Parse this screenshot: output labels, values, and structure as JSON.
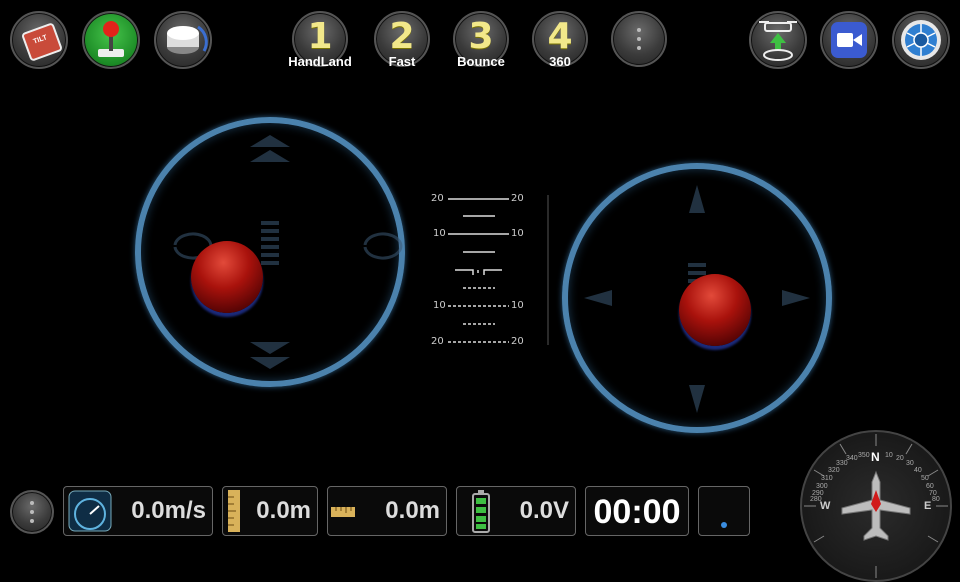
{
  "top_left": {
    "tilt_icon_text": "TILT"
  },
  "modes": [
    {
      "num": "1",
      "label": "HandLand"
    },
    {
      "num": "2",
      "label": "Fast"
    },
    {
      "num": "3",
      "label": "Bounce"
    },
    {
      "num": "4",
      "label": "360"
    }
  ],
  "pitch_ladder": {
    "ticks": [
      "20",
      "20",
      "10",
      "10",
      "10",
      "10",
      "20",
      "20"
    ]
  },
  "status": {
    "speed": "0.0m/s",
    "height": "0.0m",
    "distance": "0.0m",
    "voltage": "0.0V",
    "timer": "00:00"
  },
  "compass": {
    "n": "N",
    "e": "E",
    "w": "W",
    "degrees": [
      "10",
      "20",
      "30",
      "40",
      "50",
      "60",
      "70",
      "80",
      "350",
      "340",
      "330",
      "320",
      "310",
      "300",
      "290",
      "280"
    ]
  },
  "colors": {
    "ring": "#4b82ad",
    "accent": "#f2e88a",
    "status_dot": "#3a8de0"
  }
}
